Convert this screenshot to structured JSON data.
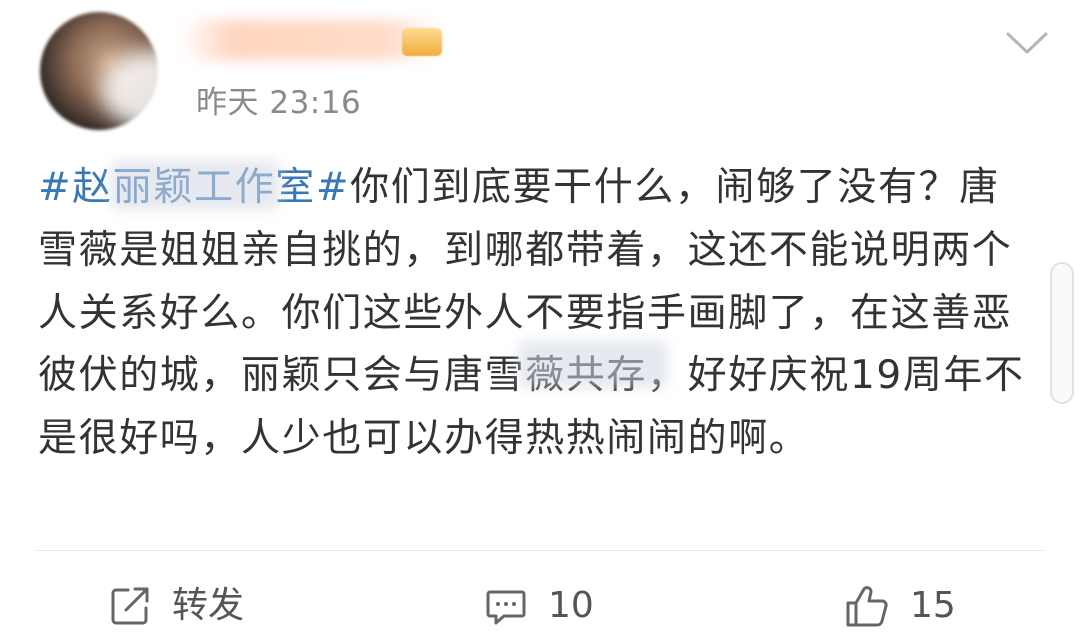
{
  "post": {
    "time": "昨天 23:16",
    "hashtag": "#赵丽颖工作室#",
    "content": "你们到底要干什么，闹够了没有？唐雪薇是姐姐亲自挑的，到哪都带着，这还不能说明两个人关系好么。你们这些外人不要指手画脚了，在这善恶彼伏的城，丽颖只会与唐雪薇共存，好好庆祝19周年不是很好吗，人少也可以办得热热闹闹的啊。"
  },
  "actions": {
    "repost_label": "转发",
    "comment_count": "10",
    "like_count": "15"
  },
  "icons": {
    "expand": "chevron-down-icon",
    "repost": "share-icon",
    "comment": "comment-icon",
    "like": "thumbs-up-icon"
  },
  "colors": {
    "hashtag": "#3a77b5",
    "text": "#333333",
    "meta": "#8a8a8a"
  }
}
